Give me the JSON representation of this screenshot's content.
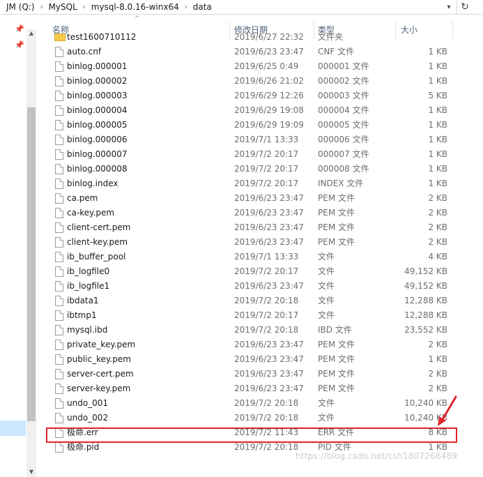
{
  "address": {
    "crumbs": [
      "JM (Q:)",
      "MySQL",
      "mysql-8.0.16-winx64",
      "data"
    ],
    "separator": "›"
  },
  "columns": {
    "name": "名称",
    "date": "修改日期",
    "type": "类型",
    "size": "大小"
  },
  "rows": [
    {
      "name": "test1600710112",
      "date": "2019/6/27 22:32",
      "type": "文件夹",
      "size": "",
      "kind": "folder"
    },
    {
      "name": "auto.cnf",
      "date": "2019/6/23 23:47",
      "type": "CNF 文件",
      "size": "1 KB",
      "kind": "file"
    },
    {
      "name": "binlog.000001",
      "date": "2019/6/25 0:49",
      "type": "000001 文件",
      "size": "1 KB",
      "kind": "file"
    },
    {
      "name": "binlog.000002",
      "date": "2019/6/26 21:02",
      "type": "000002 文件",
      "size": "1 KB",
      "kind": "file"
    },
    {
      "name": "binlog.000003",
      "date": "2019/6/29 12:26",
      "type": "000003 文件",
      "size": "5 KB",
      "kind": "file"
    },
    {
      "name": "binlog.000004",
      "date": "2019/6/29 19:08",
      "type": "000004 文件",
      "size": "1 KB",
      "kind": "file"
    },
    {
      "name": "binlog.000005",
      "date": "2019/6/29 19:09",
      "type": "000005 文件",
      "size": "1 KB",
      "kind": "file"
    },
    {
      "name": "binlog.000006",
      "date": "2019/7/1 13:33",
      "type": "000006 文件",
      "size": "1 KB",
      "kind": "file"
    },
    {
      "name": "binlog.000007",
      "date": "2019/7/2 20:17",
      "type": "000007 文件",
      "size": "1 KB",
      "kind": "file"
    },
    {
      "name": "binlog.000008",
      "date": "2019/7/2 20:17",
      "type": "000008 文件",
      "size": "1 KB",
      "kind": "file"
    },
    {
      "name": "binlog.index",
      "date": "2019/7/2 20:17",
      "type": "INDEX 文件",
      "size": "1 KB",
      "kind": "file"
    },
    {
      "name": "ca.pem",
      "date": "2019/6/23 23:47",
      "type": "PEM 文件",
      "size": "2 KB",
      "kind": "file"
    },
    {
      "name": "ca-key.pem",
      "date": "2019/6/23 23:47",
      "type": "PEM 文件",
      "size": "2 KB",
      "kind": "file"
    },
    {
      "name": "client-cert.pem",
      "date": "2019/6/23 23:47",
      "type": "PEM 文件",
      "size": "2 KB",
      "kind": "file"
    },
    {
      "name": "client-key.pem",
      "date": "2019/6/23 23:47",
      "type": "PEM 文件",
      "size": "2 KB",
      "kind": "file"
    },
    {
      "name": "ib_buffer_pool",
      "date": "2019/7/1 13:33",
      "type": "文件",
      "size": "4 KB",
      "kind": "file"
    },
    {
      "name": "ib_logfile0",
      "date": "2019/7/2 20:17",
      "type": "文件",
      "size": "49,152 KB",
      "kind": "file"
    },
    {
      "name": "ib_logfile1",
      "date": "2019/6/23 23:47",
      "type": "文件",
      "size": "49,152 KB",
      "kind": "file"
    },
    {
      "name": "ibdata1",
      "date": "2019/7/2 20:18",
      "type": "文件",
      "size": "12,288 KB",
      "kind": "file"
    },
    {
      "name": "ibtmp1",
      "date": "2019/7/2 20:17",
      "type": "文件",
      "size": "12,288 KB",
      "kind": "file"
    },
    {
      "name": "mysql.ibd",
      "date": "2019/7/2 20:18",
      "type": "IBD 文件",
      "size": "23,552 KB",
      "kind": "file"
    },
    {
      "name": "private_key.pem",
      "date": "2019/6/23 23:47",
      "type": "PEM 文件",
      "size": "2 KB",
      "kind": "file"
    },
    {
      "name": "public_key.pem",
      "date": "2019/6/23 23:47",
      "type": "PEM 文件",
      "size": "1 KB",
      "kind": "file"
    },
    {
      "name": "server-cert.pem",
      "date": "2019/6/23 23:47",
      "type": "PEM 文件",
      "size": "2 KB",
      "kind": "file"
    },
    {
      "name": "server-key.pem",
      "date": "2019/6/23 23:47",
      "type": "PEM 文件",
      "size": "2 KB",
      "kind": "file"
    },
    {
      "name": "undo_001",
      "date": "2019/7/2 20:18",
      "type": "文件",
      "size": "10,240 KB",
      "kind": "file"
    },
    {
      "name": "undo_002",
      "date": "2019/7/2 20:18",
      "type": "文件",
      "size": "10,240 KB",
      "kind": "file"
    },
    {
      "name": "极命.err",
      "date": "2019/7/2 11:43",
      "type": "ERR 文件",
      "size": "8 KB",
      "kind": "file",
      "highlighted": true
    },
    {
      "name": "极命.pid",
      "date": "2019/7/2 20:18",
      "type": "PID 文件",
      "size": "1 KB",
      "kind": "file"
    }
  ],
  "watermark": "https://blog.csdn.net/csh1807266489",
  "colors": {
    "highlight": "#e0242a",
    "header_text": "#4c607a",
    "selection": "#cce8ff"
  }
}
